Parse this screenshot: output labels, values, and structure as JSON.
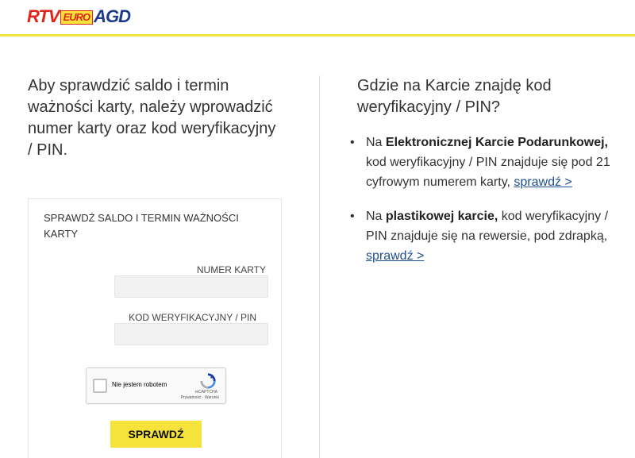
{
  "header": {
    "logo": {
      "part1": "RTV",
      "part2": "EURO",
      "part3": "AGD"
    },
    "colors": {
      "accent": "#f5e33c",
      "logo_red": "#e1251b",
      "logo_blue": "#1d3a8f"
    }
  },
  "intro": {
    "text": "Aby sprawdzić saldo i termin ważności karty, należy wprowadzić numer karty oraz kod weryfikacyjny / PIN."
  },
  "form": {
    "title": "SPRAWDŹ SALDO I TERMIN WAŻNOŚCI KARTY",
    "card_label": "NUMER KARTY",
    "card_value": "",
    "pin_label": "KOD WERYFIKACYJNY / PIN",
    "pin_value": "",
    "captcha": {
      "label": "Nie jestem robotem",
      "brand": "reCAPTCHA",
      "terms": "Prywatność - Warunki"
    },
    "submit_label": "SPRAWDŹ"
  },
  "help": {
    "title": "Gdzie na Karcie znajdę kod weryfikacyjny / PIN?",
    "items": [
      {
        "before": "Na ",
        "bold": "Elektronicznej Karcie Podarunkowej,",
        "after": " kod weryfikacyjny / PIN znajduje się pod 21 cyfrowym numerem karty, ",
        "link": "sprawdź >"
      },
      {
        "before": "Na ",
        "bold": "plastikowej karcie,",
        "after": " kod weryfikacyjny / PIN znajduje się na rewersie, pod zdrapką, ",
        "link": "sprawdź >"
      }
    ]
  }
}
